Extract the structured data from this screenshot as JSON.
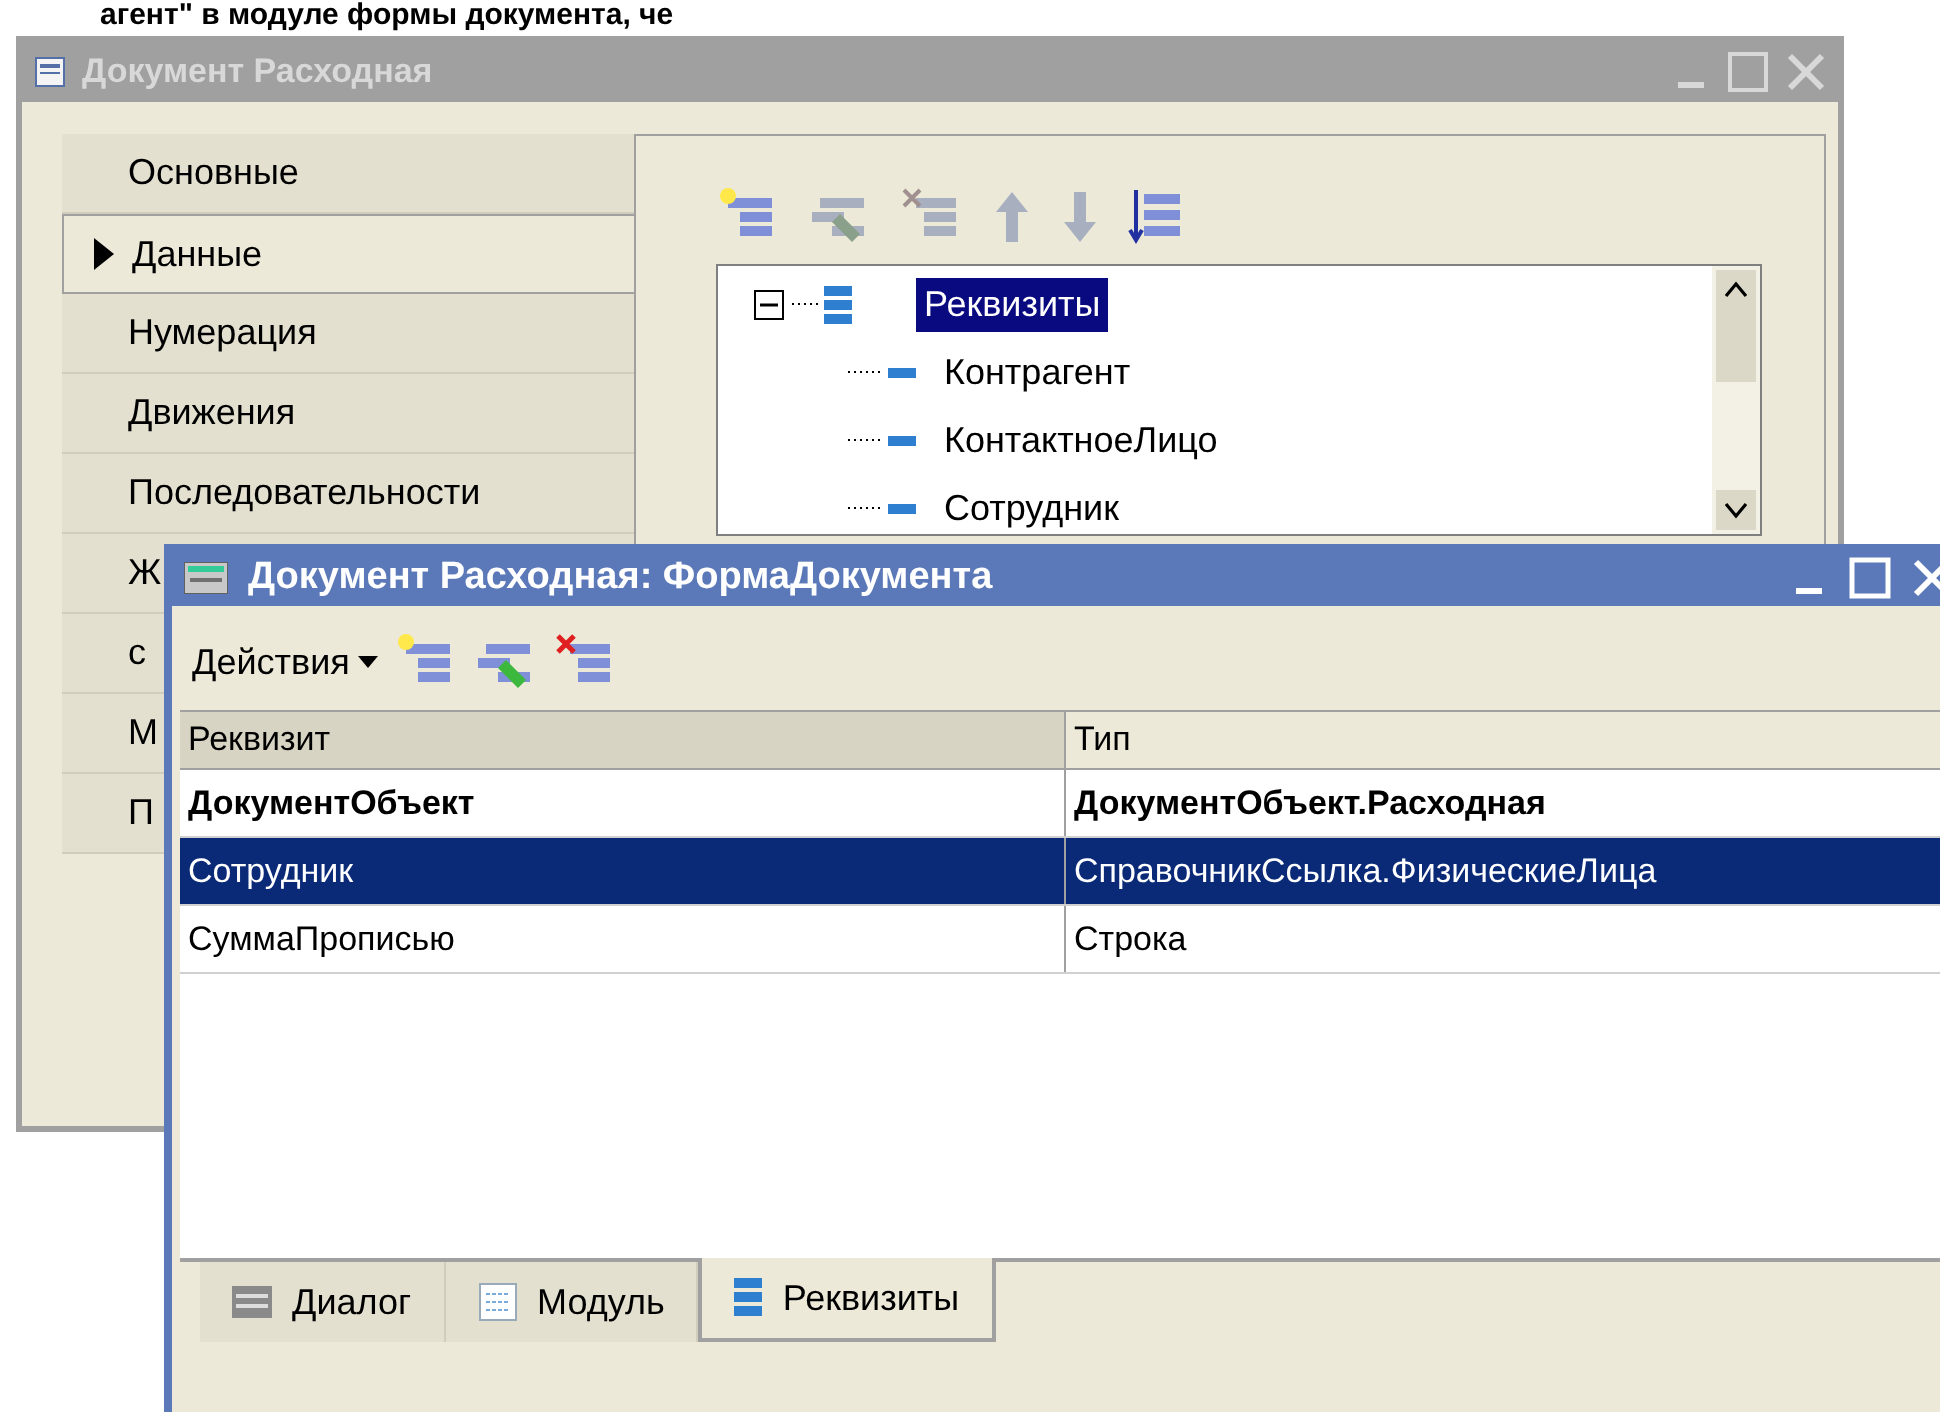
{
  "caption": "агент\" в модуле формы документа, че",
  "back_window": {
    "title": "Документ Расходная",
    "tabs": [
      {
        "label": "Основные",
        "selected": false
      },
      {
        "label": "Данные",
        "selected": true
      },
      {
        "label": "Нумерация",
        "selected": false
      },
      {
        "label": "Движения",
        "selected": false
      },
      {
        "label": "Последовательности",
        "selected": false
      },
      {
        "label": "Ж",
        "selected": false
      },
      {
        "label": "с",
        "selected": false
      },
      {
        "label": "М",
        "selected": false
      },
      {
        "label": "П",
        "selected": false
      }
    ],
    "tree": {
      "label": "Реквизиты",
      "selected": true,
      "expanded": true,
      "children": [
        {
          "label": "Контрагент"
        },
        {
          "label": "КонтактноеЛицо"
        },
        {
          "label": "Сотрудник"
        }
      ]
    }
  },
  "front_window": {
    "title": "Документ Расходная: ФормаДокумента",
    "actions": "Действия",
    "table": {
      "columns": [
        "Реквизит",
        "Тип"
      ],
      "rows": [
        {
          "kind": "object",
          "selected": false,
          "cells": [
            "ДокументОбъект",
            "ДокументОбъект.Расходная"
          ]
        },
        {
          "kind": "attribute",
          "selected": true,
          "cells": [
            "Сотрудник",
            "СправочникСсылка.ФизическиеЛица"
          ]
        },
        {
          "kind": "attribute",
          "selected": false,
          "cells": [
            "СуммаПрописью",
            "Строка"
          ]
        }
      ]
    },
    "bottom_tabs": [
      {
        "label": "Диалог",
        "kind": "dialog",
        "selected": false
      },
      {
        "label": "Модуль",
        "kind": "module",
        "selected": false
      },
      {
        "label": "Реквизиты",
        "kind": "attributes",
        "selected": true
      }
    ]
  }
}
